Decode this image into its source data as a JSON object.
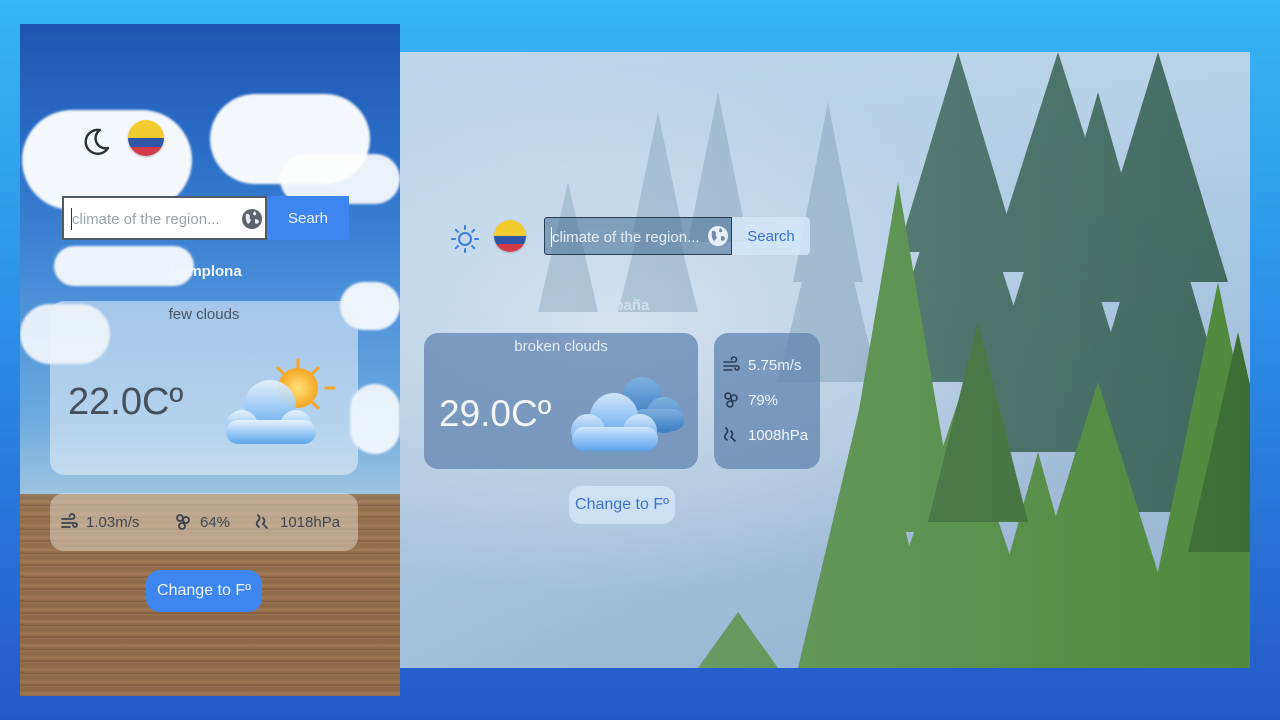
{
  "mobile": {
    "theme_icon": "moon-icon",
    "flag": "colombia-flag",
    "search": {
      "placeholder": "climate of the region...",
      "button_label": "Searh"
    },
    "city": "Pamplona",
    "weather": {
      "description": "few clouds",
      "temperature": "22.0Cº",
      "icon": "sun-behind-cloud-icon"
    },
    "stats": {
      "wind": "1.03m/s",
      "humidity": "64%",
      "pressure": "1018hPa"
    },
    "change_unit_label": "Change to Fº"
  },
  "desktop": {
    "theme_icon": "sun-icon",
    "flag": "colombia-flag",
    "search": {
      "placeholder": "climate of the region...",
      "button_label": "Search"
    },
    "country": "España",
    "weather": {
      "description": "broken clouds",
      "temperature": "29.0Cº",
      "icon": "broken-clouds-icon"
    },
    "stats": {
      "wind": "5.75m/s",
      "humidity": "79%",
      "pressure": "1008hPa"
    },
    "change_unit_label": "Change to Fº"
  },
  "colors": {
    "accent_blue": "#3d86f1",
    "card_dark": "#6284b0"
  }
}
